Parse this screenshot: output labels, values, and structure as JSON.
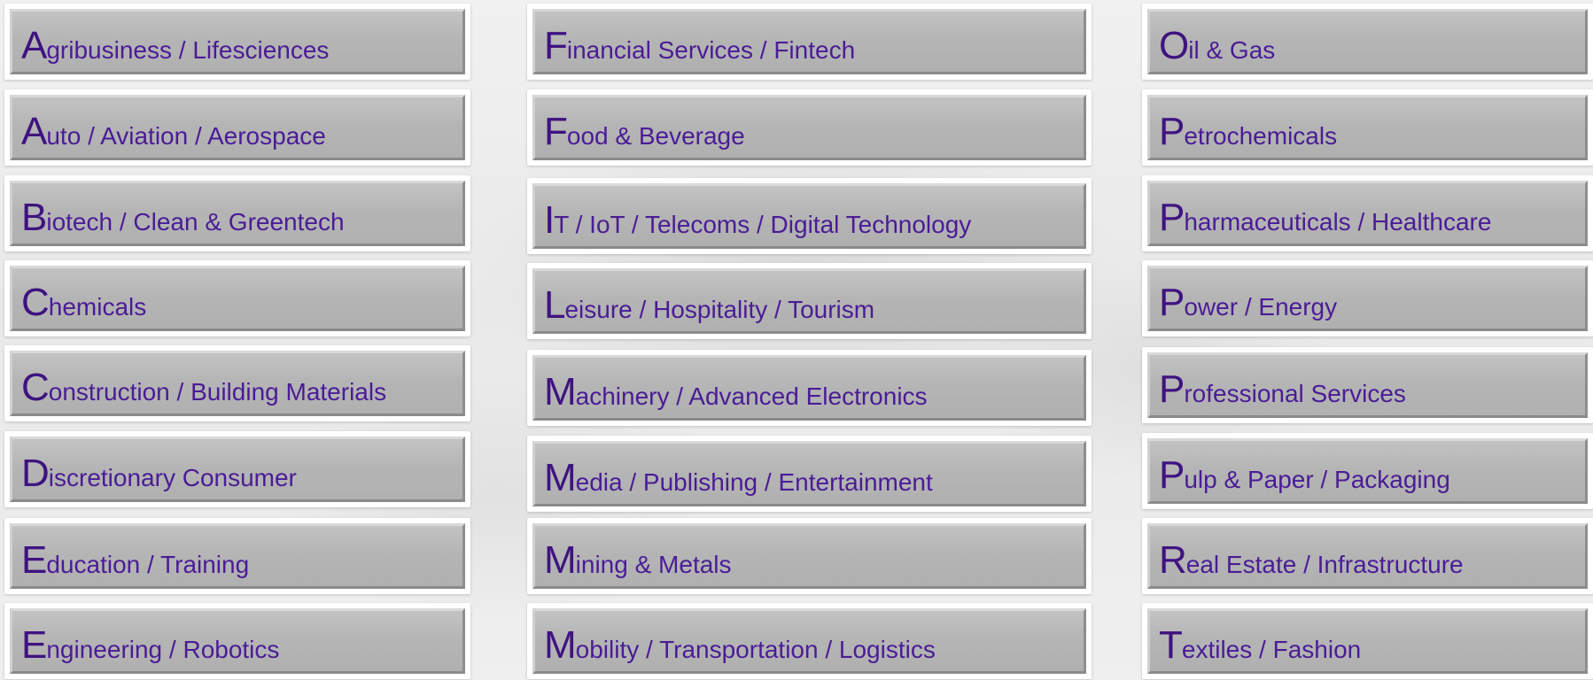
{
  "columns": [
    {
      "items": [
        {
          "initial": "A",
          "text": "gribusiness / Lifesciences"
        },
        {
          "initial": "A",
          "text": "uto / Aviation / Aerospace"
        },
        {
          "initial": "B",
          "text": "iotech / Clean & Greentech"
        },
        {
          "initial": "C",
          "text": "hemicals"
        },
        {
          "initial": "C",
          "text": "onstruction / Building Materials"
        },
        {
          "initial": "D",
          "text": "iscretionary Consumer"
        },
        {
          "initial": "E",
          "text": "ducation / Training"
        },
        {
          "initial": "E",
          "text": "ngineering / Robotics"
        }
      ]
    },
    {
      "items": [
        {
          "initial": "F",
          "text": "inancial Services / Fintech"
        },
        {
          "initial": "F",
          "text": "ood & Beverage"
        },
        {
          "initial": "I",
          "text": "T / IoT / Telecoms / Digital Technology"
        },
        {
          "initial": "L",
          "text": "eisure / Hospitality / Tourism"
        },
        {
          "initial": "M",
          "text": "achinery / Advanced Electronics"
        },
        {
          "initial": "M",
          "text": "edia / Publishing / Entertainment"
        },
        {
          "initial": "M",
          "text": "ining & Metals"
        },
        {
          "initial": "M",
          "text": "obility / Transportation / Logistics"
        }
      ]
    },
    {
      "items": [
        {
          "initial": "O",
          "text": "il & Gas"
        },
        {
          "initial": "P",
          "text": "etrochemicals"
        },
        {
          "initial": "P",
          "text": "harmaceuticals / Healthcare"
        },
        {
          "initial": "P",
          "text": "ower / Energy"
        },
        {
          "initial": "P",
          "text": "rofessional Services"
        },
        {
          "initial": "P",
          "text": "ulp & Paper / Packaging"
        },
        {
          "initial": "R",
          "text": "eal Estate / Infrastructure"
        },
        {
          "initial": "T",
          "text": "extiles / Fashion"
        }
      ]
    }
  ],
  "colors": {
    "initial": "#3f1380",
    "text": "#4a1c96",
    "button_fill": "#b5b5b5",
    "frame": "#ffffff"
  }
}
